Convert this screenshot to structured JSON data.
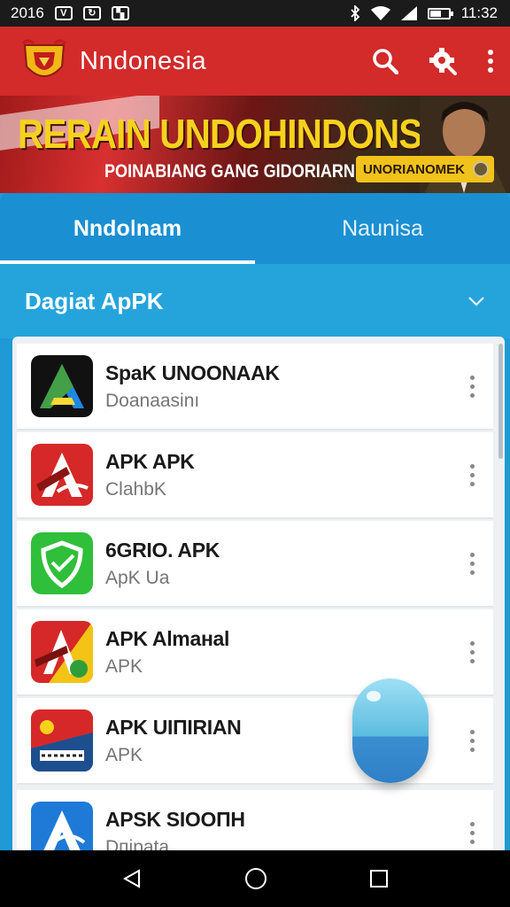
{
  "status_bar": {
    "left_text": "2016",
    "time": "11:32",
    "icons": [
      "notification-v-icon",
      "notification-sync-icon",
      "notification-image-icon",
      "bluetooth-icon",
      "wifi-icon",
      "signal-icon",
      "battery-icon"
    ]
  },
  "app_bar": {
    "title": "Nndonesia",
    "actions": [
      "search-icon",
      "settings-icon",
      "more-vert-icon"
    ]
  },
  "banner": {
    "headline": "RERAIN UNDOHINDONSIA",
    "subtitle": "POINABIANG GANG GIDORIARN",
    "badge": "UNORIANOMEK"
  },
  "tabs": [
    {
      "label": "Nndoǀnam",
      "active": true
    },
    {
      "label": "Naunisa",
      "active": false
    }
  ],
  "section": {
    "title": "Dagiat ApPK"
  },
  "apps": [
    {
      "title": "SpaK UNOONAAK",
      "subtitle": "Doanaasinı",
      "icon": "a-triangle-icon"
    },
    {
      "title": "APK APK",
      "subtitle": "ClahbK",
      "icon": "red-a-icon"
    },
    {
      "title": "6GRIO. APK",
      "subtitle": "ApK Ua",
      "icon": "shield-icon"
    },
    {
      "title": "APK Almaнal",
      "subtitle": "APK",
      "icon": "red-yellow-a-icon"
    },
    {
      "title": "APK UIПIRIAN",
      "subtitle": "APK",
      "icon": "flag-icon"
    },
    {
      "title": "APSK SIOOПH",
      "subtitle": "Dпiрata",
      "icon": "blue-a-icon"
    }
  ],
  "colors": {
    "app_bar": "#d32a2a",
    "tabs": "#1a8fd2",
    "section": "#25a4dc",
    "banner_text": "#f5d21c"
  }
}
